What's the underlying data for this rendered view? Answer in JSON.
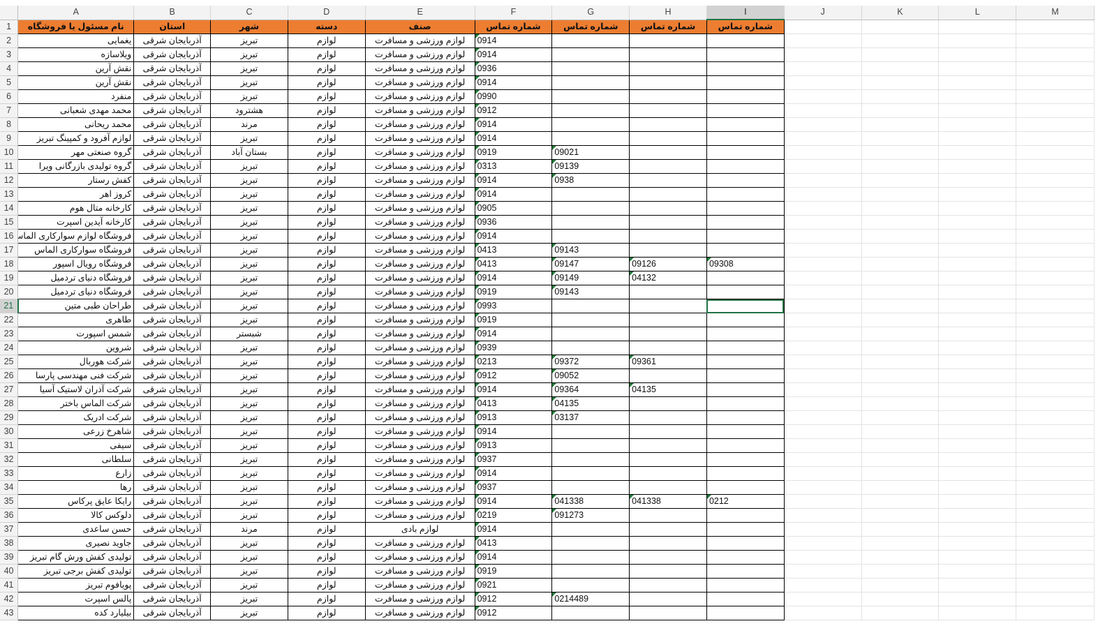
{
  "columns": [
    "A",
    "B",
    "C",
    "D",
    "E",
    "F",
    "G",
    "H",
    "I",
    "J",
    "K",
    "L",
    "M"
  ],
  "selected_column": "I",
  "selected_row": 21,
  "headers": [
    "نام مسئول یا فروشگاه",
    "استان",
    "شهر",
    "دسته",
    "صنف",
    "شماره تماس",
    "شماره تماس",
    "شماره تماس",
    "شماره تماس"
  ],
  "rows": [
    {
      "n": "2",
      "name": "یغمایی",
      "prov": "آذربایجان شرقی",
      "city": "تبریز",
      "cat": "لوازم",
      "trade": "لوازم ورزشی و مسافرت",
      "p": [
        "0914"
      ]
    },
    {
      "n": "3",
      "name": "ویلاسازه",
      "prov": "آذربایجان شرقی",
      "city": "تبریز",
      "cat": "لوازم",
      "trade": "لوازم ورزشی و مسافرت",
      "p": [
        "0914"
      ]
    },
    {
      "n": "4",
      "name": "نقش آرین",
      "prov": "آذربایجان شرقی",
      "city": "تبریز",
      "cat": "لوازم",
      "trade": "لوازم ورزشی و مسافرت",
      "p": [
        "0936"
      ]
    },
    {
      "n": "5",
      "name": "نقش آرین",
      "prov": "آذربایجان شرقی",
      "city": "تبریز",
      "cat": "لوازم",
      "trade": "لوازم ورزشی و مسافرت",
      "p": [
        "0914"
      ]
    },
    {
      "n": "6",
      "name": "منفرد",
      "prov": "آذربایجان شرقی",
      "city": "تبریز",
      "cat": "لوازم",
      "trade": "لوازم ورزشی و مسافرت",
      "p": [
        "0990"
      ]
    },
    {
      "n": "7",
      "name": "محمد مهدی شعبانی",
      "prov": "آذربایجان شرقی",
      "city": "هشترود",
      "cat": "لوازم",
      "trade": "لوازم ورزشی و مسافرت",
      "p": [
        "0912"
      ]
    },
    {
      "n": "8",
      "name": "محمد ریحانی",
      "prov": "آذربایجان شرقی",
      "city": "مرند",
      "cat": "لوازم",
      "trade": "لوازم ورزشی و مسافرت",
      "p": [
        "0914"
      ]
    },
    {
      "n": "9",
      "name": "لوازم آفرود و کمپینگ تبریز",
      "prov": "آذربایجان شرقی",
      "city": "تبریز",
      "cat": "لوازم",
      "trade": "لوازم ورزشی و مسافرت",
      "p": [
        "0914"
      ]
    },
    {
      "n": "10",
      "name": "گروه صنعتی مهر",
      "prov": "آذربایجان شرقی",
      "city": "بستان آباد",
      "cat": "لوازم",
      "trade": "لوازم ورزشی و مسافرت",
      "p": [
        "0919",
        "09021"
      ]
    },
    {
      "n": "11",
      "name": "گروه تولیدی بازرگانی ویرا",
      "prov": "آذربایجان شرقی",
      "city": "تبریز",
      "cat": "لوازم",
      "trade": "لوازم ورزشی و مسافرت",
      "p": [
        "0313",
        "09139"
      ]
    },
    {
      "n": "12",
      "name": "کفش رستار",
      "prov": "آذربایجان شرقی",
      "city": "تبریز",
      "cat": "لوازم",
      "trade": "لوازم ورزشی و مسافرت",
      "p": [
        "0914",
        "0938"
      ]
    },
    {
      "n": "13",
      "name": "کروز اهر",
      "prov": "آذربایجان شرقی",
      "city": "تبریز",
      "cat": "لوازم",
      "trade": "لوازم ورزشی و مسافرت",
      "p": [
        "0914"
      ]
    },
    {
      "n": "14",
      "name": "کارخانه متال هوم",
      "prov": "آذربایجان شرقی",
      "city": "تبریز",
      "cat": "لوازم",
      "trade": "لوازم ورزشی و مسافرت",
      "p": [
        "0905"
      ]
    },
    {
      "n": "15",
      "name": "کارخانه آیدین اسپرت",
      "prov": "آذربایجان شرقی",
      "city": "تبریز",
      "cat": "لوازم",
      "trade": "لوازم ورزشی و مسافرت",
      "p": [
        "0936"
      ]
    },
    {
      "n": "16",
      "name": "فروشگاه لوازم سوارکاری الماس",
      "prov": "آذربایجان شرقی",
      "city": "تبریز",
      "cat": "لوازم",
      "trade": "لوازم ورزشی و مسافرت",
      "p": [
        "0914"
      ]
    },
    {
      "n": "17",
      "name": "فروشگاه سوارکاری الماس",
      "prov": "آذربایجان شرقی",
      "city": "تبریز",
      "cat": "لوازم",
      "trade": "لوازم ورزشی و مسافرت",
      "p": [
        "0413",
        "09143"
      ]
    },
    {
      "n": "18",
      "name": "فروشگاه رویال اسپور",
      "prov": "آذربایجان شرقی",
      "city": "تبریز",
      "cat": "لوازم",
      "trade": "لوازم ورزشی و مسافرت",
      "p": [
        "0413",
        "09147",
        "09126",
        "09308"
      ]
    },
    {
      "n": "19",
      "name": "فروشگاه دنیای تردمیل",
      "prov": "آذربایجان شرقی",
      "city": "تبریز",
      "cat": "لوازم",
      "trade": "لوازم ورزشی و مسافرت",
      "p": [
        "0914",
        "09149",
        "04132"
      ]
    },
    {
      "n": "20",
      "name": "فروشگاه دنیای تردمیل",
      "prov": "آذربایجان شرقی",
      "city": "تبریز",
      "cat": "لوازم",
      "trade": "لوازم ورزشی و مسافرت",
      "p": [
        "0919",
        "09143"
      ]
    },
    {
      "n": "21",
      "name": "طراحان طبی متین",
      "prov": "آذربایجان شرقی",
      "city": "تبریز",
      "cat": "لوازم",
      "trade": "لوازم ورزشی و مسافرت",
      "p": [
        "0993"
      ]
    },
    {
      "n": "22",
      "name": "طاهری",
      "prov": "آذربایجان شرقی",
      "city": "تبریز",
      "cat": "لوازم",
      "trade": "لوازم ورزشی و مسافرت",
      "p": [
        "0919"
      ]
    },
    {
      "n": "23",
      "name": "شمس اسپورت",
      "prov": "آذربایجان شرقی",
      "city": "شبستر",
      "cat": "لوازم",
      "trade": "لوازم ورزشی و مسافرت",
      "p": [
        "0914"
      ]
    },
    {
      "n": "24",
      "name": "شروین",
      "prov": "آذربایجان شرقی",
      "city": "تبریز",
      "cat": "لوازم",
      "trade": "لوازم ورزشی و مسافرت",
      "p": [
        "0939"
      ]
    },
    {
      "n": "25",
      "name": "شرکت هوربال",
      "prov": "آذربایجان شرقی",
      "city": "تبریز",
      "cat": "لوازم",
      "trade": "لوازم ورزشی و مسافرت",
      "p": [
        "0213",
        "09372",
        "09361"
      ]
    },
    {
      "n": "26",
      "name": "شرکت فنی مهندسی پارسا",
      "prov": "آذربایجان شرقی",
      "city": "تبریز",
      "cat": "لوازم",
      "trade": "لوازم ورزشی و مسافرت",
      "p": [
        "0912",
        "09052"
      ]
    },
    {
      "n": "27",
      "name": "شرکت آذران لاستیک آسیا",
      "prov": "آذربایجان شرقی",
      "city": "تبریز",
      "cat": "لوازم",
      "trade": "لوازم ورزشی و مسافرت",
      "p": [
        "0914",
        "09364",
        "04135"
      ]
    },
    {
      "n": "28",
      "name": "شرکت الماس باختر",
      "prov": "آذربایجان شرقی",
      "city": "تبریز",
      "cat": "لوازم",
      "trade": "لوازم ورزشی و مسافرت",
      "p": [
        "0413",
        "04135"
      ]
    },
    {
      "n": "29",
      "name": "شرکت ادریک",
      "prov": "آذربایجان شرقی",
      "city": "تبریز",
      "cat": "لوازم",
      "trade": "لوازم ورزشی و مسافرت",
      "p": [
        "0913",
        "03137"
      ]
    },
    {
      "n": "30",
      "name": "شاهرخ زرعی",
      "prov": "آذربایجان شرقی",
      "city": "تبریز",
      "cat": "لوازم",
      "trade": "لوازم ورزشی و مسافرت",
      "p": [
        "0914"
      ]
    },
    {
      "n": "31",
      "name": "سیفی",
      "prov": "آذربایجان شرقی",
      "city": "تبریز",
      "cat": "لوازم",
      "trade": "لوازم ورزشی و مسافرت",
      "p": [
        "0913"
      ]
    },
    {
      "n": "32",
      "name": "سلطانی",
      "prov": "آذربایجان شرقی",
      "city": "تبریز",
      "cat": "لوازم",
      "trade": "لوازم ورزشی و مسافرت",
      "p": [
        "0937"
      ]
    },
    {
      "n": "33",
      "name": "زارع",
      "prov": "آذربایجان شرقی",
      "city": "تبریز",
      "cat": "لوازم",
      "trade": "لوازم ورزشی و مسافرت",
      "p": [
        "0914"
      ]
    },
    {
      "n": "34",
      "name": "رها",
      "prov": "آذربایجان شرقی",
      "city": "تبریز",
      "cat": "لوازم",
      "trade": "لوازم ورزشی و مسافرت",
      "p": [
        "0937"
      ]
    },
    {
      "n": "35",
      "name": "رایکا عایق پرکاس",
      "prov": "آذربایجان شرقی",
      "city": "تبریز",
      "cat": "لوازم",
      "trade": "لوازم ورزشی و مسافرت",
      "p": [
        "0914",
        "041338",
        "041338",
        "0212"
      ]
    },
    {
      "n": "36",
      "name": "دلوکس کالا",
      "prov": "آذربایجان شرقی",
      "city": "تبریز",
      "cat": "لوازم",
      "trade": "لوازم ورزشی و مسافرت",
      "p": [
        "0219",
        "091273"
      ]
    },
    {
      "n": "37",
      "name": "حسن ساعدی",
      "prov": "آذربایجان شرقی",
      "city": "مرند",
      "cat": "لوازم",
      "trade": "لوازم بادی",
      "p": [
        "0914"
      ]
    },
    {
      "n": "38",
      "name": "جاوید نصیری",
      "prov": "آذربایجان شرقی",
      "city": "تبریز",
      "cat": "لوازم",
      "trade": "لوازم ورزشی و مسافرت",
      "p": [
        "0413"
      ]
    },
    {
      "n": "39",
      "name": "تولیدی کفش ورش گام تبریز",
      "prov": "آذربایجان شرقی",
      "city": "تبریز",
      "cat": "لوازم",
      "trade": "لوازم ورزشی و مسافرت",
      "p": [
        "0914"
      ]
    },
    {
      "n": "40",
      "name": "تولیدی کفش برجی تبریز",
      "prov": "آذربایجان شرقی",
      "city": "تبریز",
      "cat": "لوازم",
      "trade": "لوازم ورزشی و مسافرت",
      "p": [
        "0919"
      ]
    },
    {
      "n": "41",
      "name": "پویافوم تبریز",
      "prov": "آذربایجان شرقی",
      "city": "تبریز",
      "cat": "لوازم",
      "trade": "لوازم ورزشی و مسافرت",
      "p": [
        "0921"
      ]
    },
    {
      "n": "42",
      "name": "پالس اسپرت",
      "prov": "آذربایجان شرقی",
      "city": "تبریز",
      "cat": "لوازم",
      "trade": "لوازم ورزشی و مسافرت",
      "p": [
        "0912",
        "0214489"
      ]
    },
    {
      "n": "43",
      "name": "بیلیارد کده",
      "prov": "آذربایجان شرقی",
      "city": "تبریز",
      "cat": "لوازم",
      "trade": "لوازم ورزشی و مسافرت",
      "p": [
        "0912"
      ]
    }
  ]
}
